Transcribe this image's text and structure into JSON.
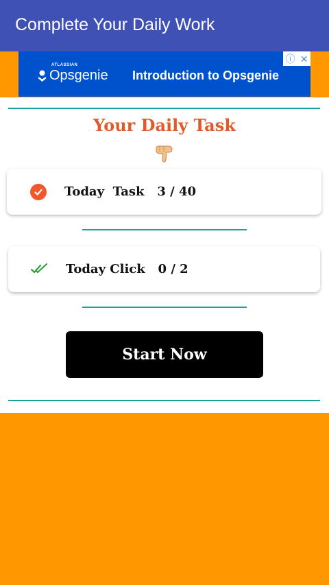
{
  "appbar": {
    "title": "Complete Your Daily Work"
  },
  "ad": {
    "brand_small": "ATLASSIAN",
    "brand": "Opsgenie",
    "headline": "Introduction to Opsgenie",
    "info_glyph": "ⓘ",
    "close_glyph": "✕"
  },
  "main": {
    "heading": "Your Daily Task",
    "hand_icon": "pointing-down-hand-icon",
    "task_card": {
      "label": "Today  Task   3 / 40",
      "icon": "check-circle-icon"
    },
    "click_card": {
      "label": "Today Click   0 / 2",
      "icon": "double-check-icon"
    },
    "start_button": "Start Now"
  },
  "colors": {
    "appbar": "#3f51b5",
    "background": "#ff9800",
    "accent": "#e05a2b",
    "rule": "#14a39b",
    "ad": "#0052cc"
  }
}
